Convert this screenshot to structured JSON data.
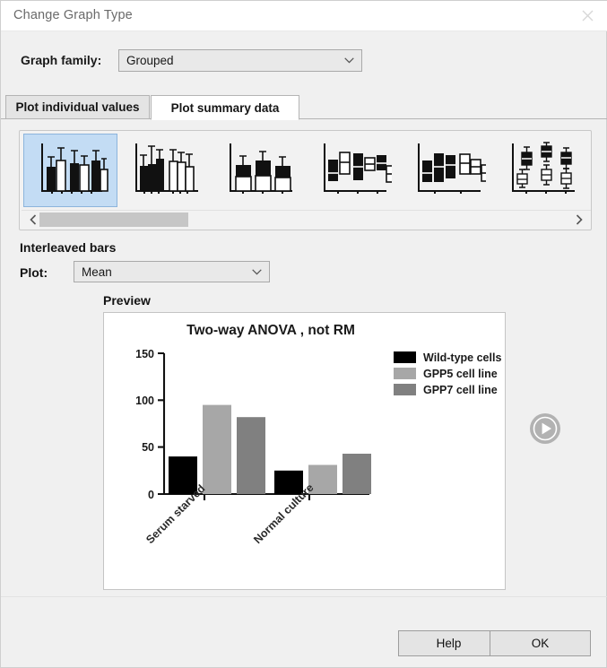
{
  "window": {
    "title": "Change Graph Type",
    "close_icon": "close-icon"
  },
  "graph_family": {
    "label": "Graph family:",
    "value": "Grouped",
    "chevron_icon": "chevron-down-icon"
  },
  "tabs": [
    {
      "label": "Plot individual values",
      "active": false
    },
    {
      "label": "Plot summary data",
      "active": true
    }
  ],
  "gallery": {
    "items": [
      {
        "name": "interleaved-bars-with-error-bars",
        "selected": true
      },
      {
        "name": "separated-bars-with-error-bars",
        "selected": false
      },
      {
        "name": "stacked-bars",
        "selected": false
      },
      {
        "name": "interleaved-floating-bars",
        "selected": false
      },
      {
        "name": "separated-floating-bars",
        "selected": false
      },
      {
        "name": "box-and-whiskers",
        "selected": false
      }
    ],
    "scroll_left_icon": "chevron-left-icon",
    "scroll_right_icon": "chevron-right-icon"
  },
  "options": {
    "section_title": "Interleaved bars",
    "plot_label": "Plot:",
    "plot_value": "Mean",
    "chevron_icon": "chevron-down-icon"
  },
  "preview": {
    "label": "Preview",
    "next_icon": "play-circle-icon"
  },
  "footer": {
    "help_label": "Help",
    "ok_label": "OK"
  },
  "colors": {
    "selection_fill": "#c3dcf4",
    "selection_border": "#8cb4dc",
    "dialog_bg": "#f0f0f0",
    "series_1": "#000000",
    "series_2": "#a7a7a7",
    "series_3": "#808080"
  },
  "chart_data": {
    "type": "bar",
    "title": "Two-way ANOVA , not RM",
    "xlabel": "",
    "ylabel": "",
    "categories": [
      "Serum starved",
      "Normal culture"
    ],
    "series": [
      {
        "name": "Wild-type cells",
        "color": "#000000",
        "values": [
          40,
          25
        ]
      },
      {
        "name": "GPP5 cell line",
        "color": "#a7a7a7",
        "values": [
          95,
          31
        ]
      },
      {
        "name": "GPP7 cell line",
        "color": "#808080",
        "values": [
          82,
          43
        ]
      }
    ],
    "ylim": [
      0,
      150
    ],
    "yticks": [
      0,
      50,
      100,
      150
    ],
    "grid": false,
    "legend_position": "top-right",
    "xtick_rotation": -45
  }
}
